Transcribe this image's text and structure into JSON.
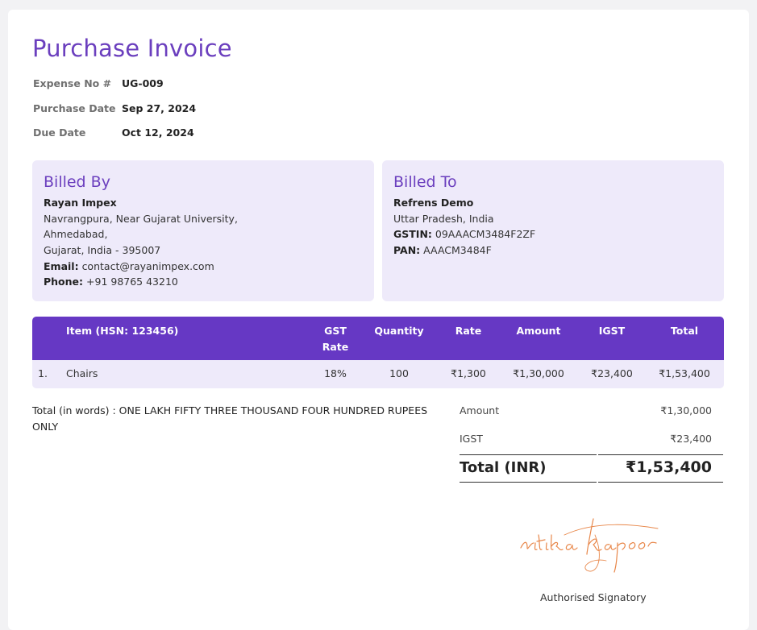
{
  "invoice": {
    "title": "Purchase Invoice",
    "meta": [
      {
        "label": "Expense No #",
        "value": "UG-009"
      },
      {
        "label": "Purchase Date",
        "value": "Sep 27, 2024"
      },
      {
        "label": "Due Date",
        "value": "Oct 12, 2024"
      }
    ]
  },
  "billed_by": {
    "heading": "Billed By",
    "name": "Rayan Impex",
    "address_1": "Navrangpura, Near Gujarat University,",
    "address_2": "Ahmedabad,",
    "address_3": "Gujarat, India - 395007",
    "email_label": "Email:",
    "email": "contact@rayanimpex.com",
    "phone_label": "Phone:",
    "phone": "+91 98765 43210"
  },
  "billed_to": {
    "heading": "Billed To",
    "name": "Refrens Demo",
    "address_1": "Uttar Pradesh, India",
    "gstin_label": "GSTIN:",
    "gstin": "09AAACM3484F2ZF",
    "pan_label": "PAN:",
    "pan": "AAACM3484F"
  },
  "table": {
    "headers": {
      "item": "Item (HSN: 123456)",
      "gst_1": "GST",
      "gst_2": "Rate",
      "qty": "Quantity",
      "rate": "Rate",
      "amount": "Amount",
      "igst": "IGST",
      "total": "Total"
    },
    "rows": [
      {
        "num": "1.",
        "item": "Chairs",
        "gst": "18%",
        "qty": "100",
        "rate": "₹1,300",
        "amount": "₹1,30,000",
        "igst": "₹23,400",
        "total": "₹1,53,400"
      }
    ]
  },
  "totals": {
    "words_1": "Total (in words) : ONE LAKH FIFTY THREE THOUSAND FOUR HUNDRED RUPEES",
    "words_2": "ONLY",
    "amount_label": "Amount",
    "amount": "₹1,30,000",
    "igst_label": "IGST",
    "igst": "₹23,400",
    "total_label": "Total (INR)",
    "total": "₹1,53,400"
  },
  "signature": {
    "text": "ritika kapoor",
    "color": "#e8874a",
    "label": "Authorised Signatory"
  }
}
